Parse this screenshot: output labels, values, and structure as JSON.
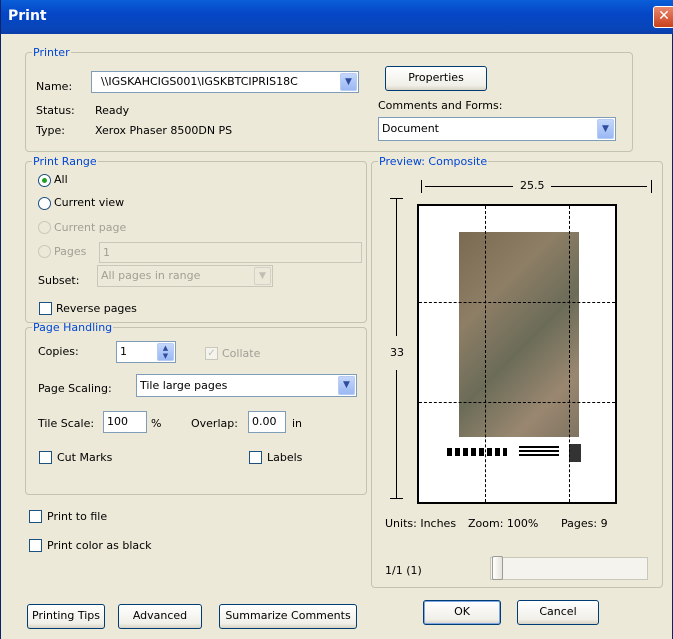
{
  "title": "Print",
  "printer": {
    "legend": "Printer",
    "name_label": "Name:",
    "name_value": "\\\\IGSKAHCIGS001\\IGSKBTCIPRIS18C",
    "status_label": "Status:",
    "status_value": "Ready",
    "type_label": "Type:",
    "type_value": "Xerox Phaser 8500DN PS",
    "properties": "Properties",
    "comments_label": "Comments and Forms:",
    "comments_value": "Document"
  },
  "range": {
    "legend": "Print Range",
    "all": "All",
    "current_view": "Current view",
    "current_page": "Current page",
    "pages": "Pages",
    "pages_value": "1",
    "subset_label": "Subset:",
    "subset_value": "All pages in range",
    "reverse": "Reverse pages"
  },
  "handling": {
    "legend": "Page Handling",
    "copies_label": "Copies:",
    "copies_value": "1",
    "collate": "Collate",
    "scaling_label": "Page Scaling:",
    "scaling_value": "Tile large pages",
    "tile_label": "Tile Scale:",
    "tile_value": "100",
    "percent": "%",
    "overlap_label": "Overlap:",
    "overlap_value": "0.00",
    "overlap_unit": "in",
    "cut_marks": "Cut Marks",
    "labels": "Labels"
  },
  "options": {
    "print_to_file": "Print to file",
    "color_black": "Print color as black"
  },
  "preview": {
    "legend": "Preview: Composite",
    "width": "25.5",
    "height": "33",
    "units": "Units: Inches",
    "zoom": "Zoom: 100%",
    "pages": "Pages: 9",
    "page_indicator": "1/1 (1)"
  },
  "buttons": {
    "tips": "Printing Tips",
    "advanced": "Advanced",
    "summarize": "Summarize Comments",
    "ok": "OK",
    "cancel": "Cancel"
  }
}
